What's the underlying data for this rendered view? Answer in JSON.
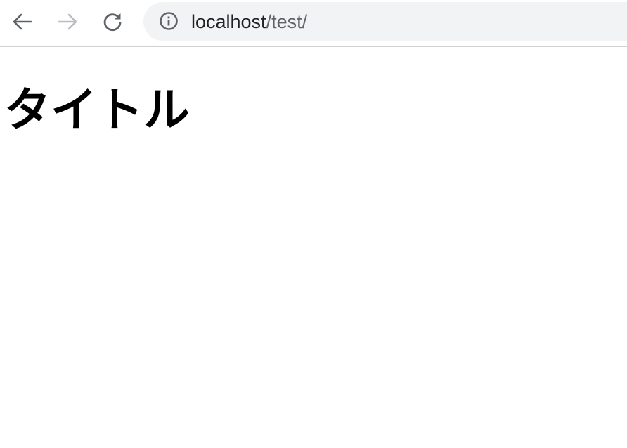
{
  "browser": {
    "back_icon": "arrow-left-icon",
    "forward_icon": "arrow-right-icon",
    "reload_icon": "reload-icon",
    "security_icon": "info-circle-icon",
    "address": {
      "host": "localhost",
      "path": "/test/"
    },
    "colors": {
      "icon_active": "#5f6368",
      "icon_disabled": "#b9bcc0",
      "omnibox_bg": "#f1f3f4",
      "host_text": "#202124",
      "path_text": "#5f6368"
    }
  },
  "page": {
    "title": "タイトル"
  }
}
